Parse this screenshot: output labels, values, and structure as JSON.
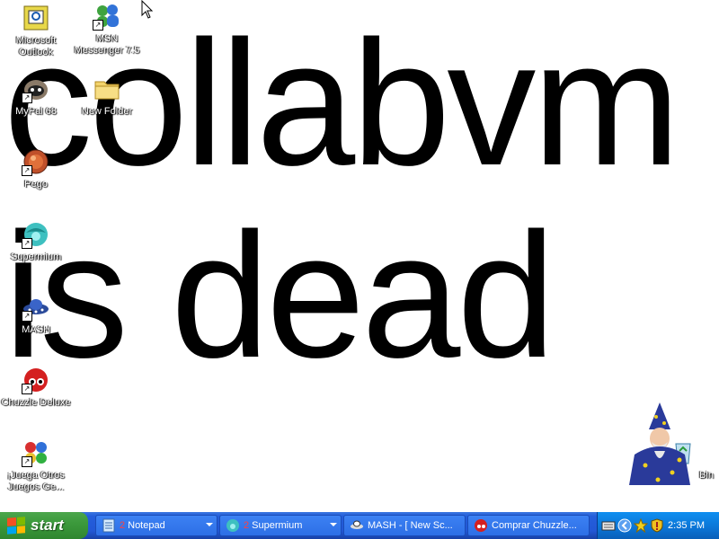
{
  "wallpaper": {
    "line1": "collabvm",
    "line2": "is dead"
  },
  "desktop_icons": [
    {
      "label": "Microsoft Outlook",
      "icon": "outlook-icon"
    },
    {
      "label": "MSN Messenger 7.5",
      "icon": "msn-messenger-icon"
    },
    {
      "label": "MyPal 68",
      "icon": "mypal-icon"
    },
    {
      "label": "New Folder",
      "icon": "folder-icon"
    },
    {
      "label": "Pego",
      "icon": "pego-icon"
    },
    {
      "label": "Supermium",
      "icon": "supermium-icon"
    },
    {
      "label": "MASH",
      "icon": "mash-icon"
    },
    {
      "label": "Chuzzle Deluxe",
      "icon": "chuzzle-icon"
    },
    {
      "label": "¡Juega Otros Juegos Ge...",
      "icon": "games-icon"
    },
    {
      "label": "Bin",
      "icon": "recycle-bin-icon"
    }
  ],
  "taskbar": {
    "start_label": "start",
    "tasks": [
      {
        "count": "2",
        "label": "Notepad",
        "icon": "notepad-icon",
        "grouped": true
      },
      {
        "count": "2",
        "label": "Supermium",
        "icon": "supermium-icon",
        "grouped": true
      },
      {
        "count": "",
        "label": "MASH - [ New Sc...",
        "icon": "mash-icon",
        "grouped": false
      },
      {
        "count": "",
        "label": "Comprar Chuzzle...",
        "icon": "chuzzle-icon",
        "grouped": false
      }
    ],
    "clock": "2:35 PM"
  },
  "colors": {
    "taskbar": "#245edb",
    "start": "#3c9a3c",
    "tray": "#0b74d5",
    "desktop": "#ffffff"
  }
}
